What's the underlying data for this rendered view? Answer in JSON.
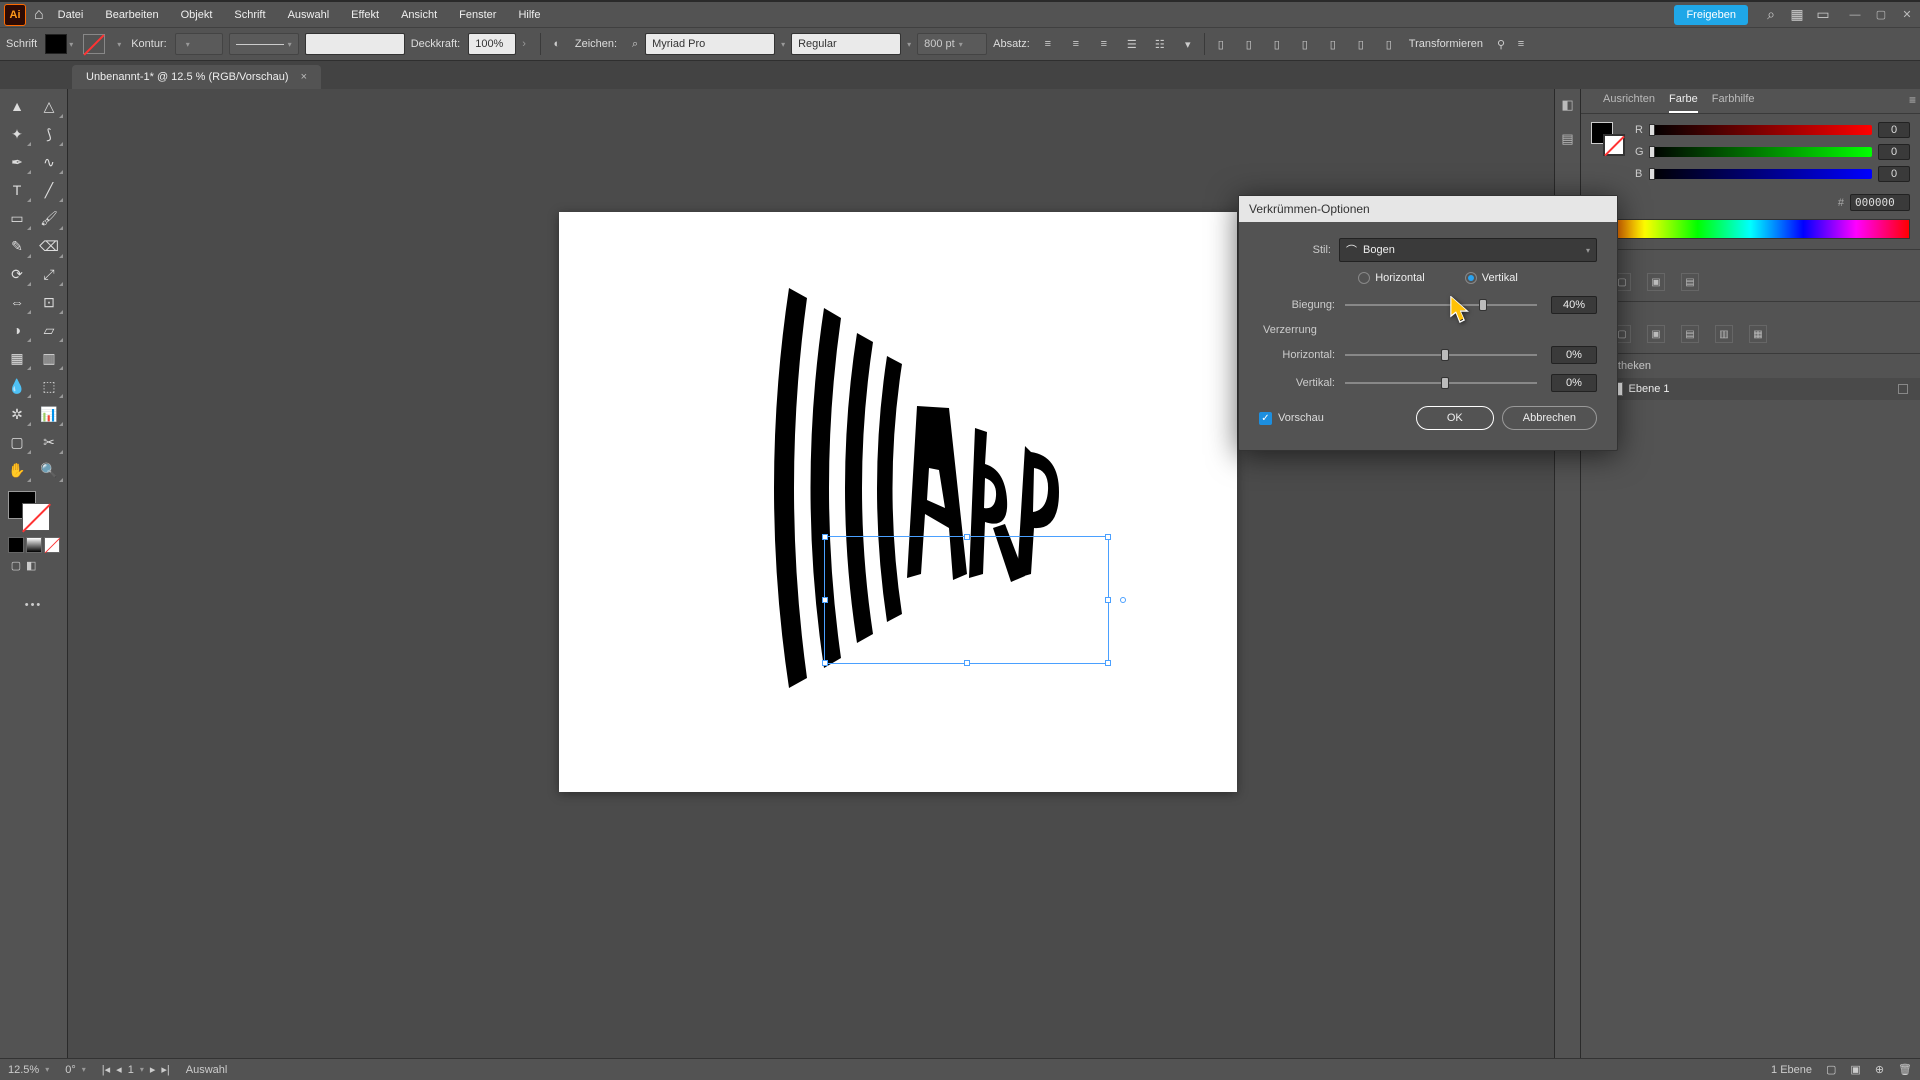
{
  "menu": {
    "logo": "Ai",
    "items": [
      "Datei",
      "Bearbeiten",
      "Objekt",
      "Schrift",
      "Auswahl",
      "Effekt",
      "Ansicht",
      "Fenster",
      "Hilfe"
    ],
    "share": "Freigeben"
  },
  "control": {
    "tool_label": "Schrift",
    "kontur": "Kontur:",
    "opacity_label": "Deckkraft:",
    "opacity_value": "100%",
    "zeichen": "Zeichen:",
    "font": "Myriad Pro",
    "weight": "Regular",
    "size": "800 pt",
    "absatz": "Absatz:",
    "transform": "Transformieren"
  },
  "tab": {
    "title": "Unbenannt-1* @ 12.5 % (RGB/Vorschau)"
  },
  "color_panel": {
    "tabs": [
      "Ausrichten",
      "Farbe",
      "Farbhilfe"
    ],
    "r": "0",
    "g": "0",
    "b": "0",
    "hex": "000000"
  },
  "layers": {
    "lib_title": "Bibliotheken",
    "layer_name": "Ebene 1"
  },
  "dialog": {
    "title": "Verkrümmen-Optionen",
    "style_label": "Stil:",
    "style_value": "Bogen",
    "horizontal": "Horizontal",
    "vertical": "Vertikal",
    "bend_label": "Biegung:",
    "bend_value": "40%",
    "distort_section": "Verzerrung",
    "dhoriz_label": "Horizontal:",
    "dhoriz_value": "0%",
    "dvert_label": "Vertikal:",
    "dvert_value": "0%",
    "preview": "Vorschau",
    "ok": "OK",
    "cancel": "Abbrechen"
  },
  "status": {
    "zoom": "12.5%",
    "rotate": "0°",
    "page": "1",
    "sel": "Auswahl",
    "layer_count": "1 Ebene"
  }
}
